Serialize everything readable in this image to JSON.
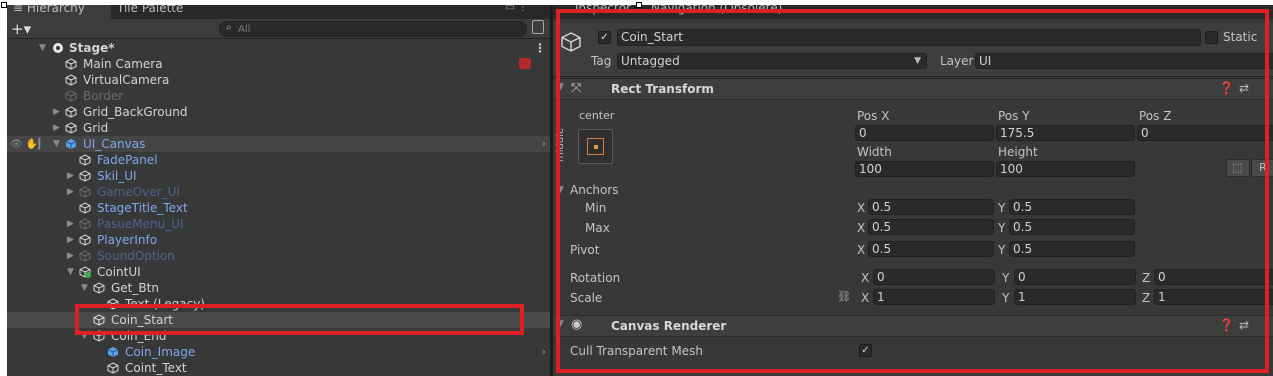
{
  "hierarchy": {
    "tab_active": "≡ Hierarchy",
    "tab_inactive": "Tile Palette",
    "add_label": "+▾",
    "search_placeholder": "All",
    "rows": [
      {
        "label": "Stage*"
      },
      {
        "label": "Main Camera"
      },
      {
        "label": "VirtualCamera"
      },
      {
        "label": "Border"
      },
      {
        "label": "Grid_BackGround"
      },
      {
        "label": "Grid"
      },
      {
        "label": "UI_Canvas"
      },
      {
        "label": "FadePanel"
      },
      {
        "label": "Skil_UI"
      },
      {
        "label": "GameOver_UI"
      },
      {
        "label": "StageTitle_Text"
      },
      {
        "label": "PasueMenu_UI"
      },
      {
        "label": "PlayerInfo"
      },
      {
        "label": "SoundOption"
      },
      {
        "label": "CointUI"
      },
      {
        "label": "Get_Btn"
      },
      {
        "label": "Text (Legacy)"
      },
      {
        "label": "Coin_Start"
      },
      {
        "label": "Coin_End"
      },
      {
        "label": "Coin_Image"
      },
      {
        "label": "Coint_Text"
      }
    ]
  },
  "inspector": {
    "tab_inspector": "Inspector",
    "tab_navigation": "Navigation (Obsolete)",
    "object_name": "Coin_Start",
    "static_label": "Static",
    "tag_label": "Tag",
    "tag_value": "Untagged",
    "layer_label": "Layer",
    "layer_value": "UI",
    "rect_transform": {
      "title": "Rect Transform",
      "anchor_h": "center",
      "anchor_v": "middle",
      "pos_x_label": "Pos X",
      "pos_x": "0",
      "pos_y_label": "Pos Y",
      "pos_y": "175.5",
      "pos_z_label": "Pos Z",
      "pos_z": "0",
      "width_label": "Width",
      "width": "100",
      "height_label": "Height",
      "height": "100",
      "anchors_label": "Anchors",
      "min_label": "Min",
      "min_x": "0.5",
      "min_y": "0.5",
      "max_label": "Max",
      "max_x": "0.5",
      "max_y": "0.5",
      "pivot_label": "Pivot",
      "pivot_x": "0.5",
      "pivot_y": "0.5",
      "rotation_label": "Rotation",
      "rot_x": "0",
      "rot_y": "0",
      "rot_z": "0",
      "scale_label": "Scale",
      "scale_x": "1",
      "scale_y": "1",
      "scale_z": "1",
      "x": "X",
      "y": "Y",
      "z": "Z",
      "r_button": "R"
    },
    "canvas_renderer": {
      "title": "Canvas Renderer",
      "cull_label": "Cull Transparent Mesh"
    }
  },
  "colors": {
    "highlight": "#e01e26",
    "prefab_blue": "#7da8ee"
  }
}
